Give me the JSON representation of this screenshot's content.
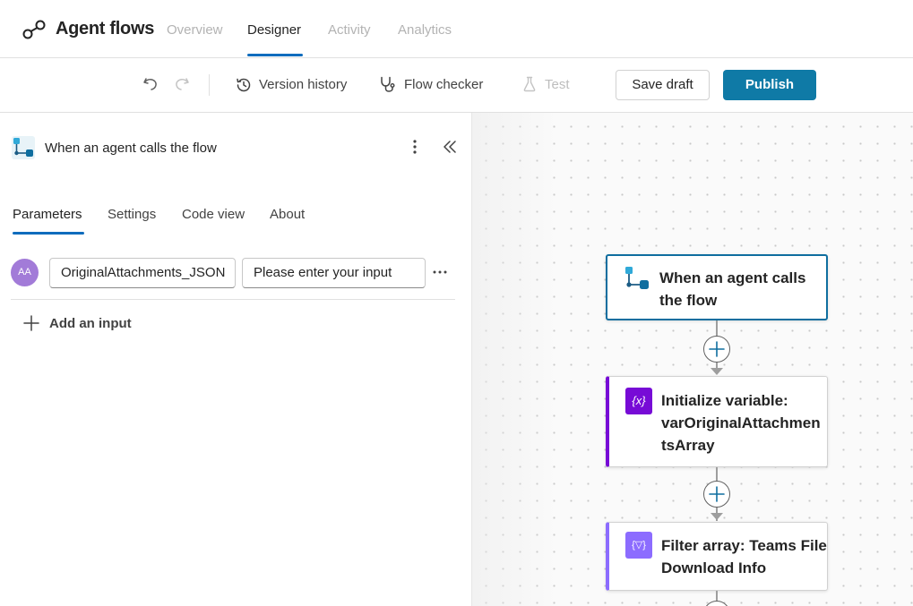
{
  "header": {
    "app_title": "Agent flows",
    "tabs": [
      {
        "label": "Overview",
        "active": false
      },
      {
        "label": "Designer",
        "active": true
      },
      {
        "label": "Activity",
        "active": false
      },
      {
        "label": "Analytics",
        "active": false
      }
    ]
  },
  "toolbar": {
    "undo_icon": "undo-icon",
    "redo_icon": "redo-icon",
    "version_history_label": "Version history",
    "flow_checker_label": "Flow checker",
    "test_label": "Test",
    "save_draft_label": "Save draft",
    "publish_label": "Publish",
    "publish_color": "#0f7aa6"
  },
  "panel": {
    "title": "When an agent calls the flow",
    "tabs": [
      {
        "label": "Parameters",
        "active": true
      },
      {
        "label": "Settings",
        "active": false
      },
      {
        "label": "Code view",
        "active": false
      },
      {
        "label": "About",
        "active": false
      }
    ],
    "input_row": {
      "avatar_text": "AA",
      "name_value": "OriginalAttachments_JSON",
      "description_placeholder": "Please enter your input"
    },
    "add_input_label": "Add an input"
  },
  "canvas": {
    "nodes": [
      {
        "title_line1": "When an agent calls",
        "title_line2": "the flow",
        "icon": "agent-trigger-icon",
        "accent": "#0f7aa6"
      },
      {
        "title_line1": "Initialize variable:",
        "title_line2": "varOriginalAttachmen",
        "title_line3": "tsArray",
        "icon": "variable-icon",
        "accent": "#770bd6",
        "icon_glyph": "{x}"
      },
      {
        "title_line1": "Filter array: Teams File",
        "title_line2": "Download Info",
        "icon": "filter-array-icon",
        "accent": "#8c6cff",
        "icon_glyph": "{▽}"
      }
    ]
  }
}
